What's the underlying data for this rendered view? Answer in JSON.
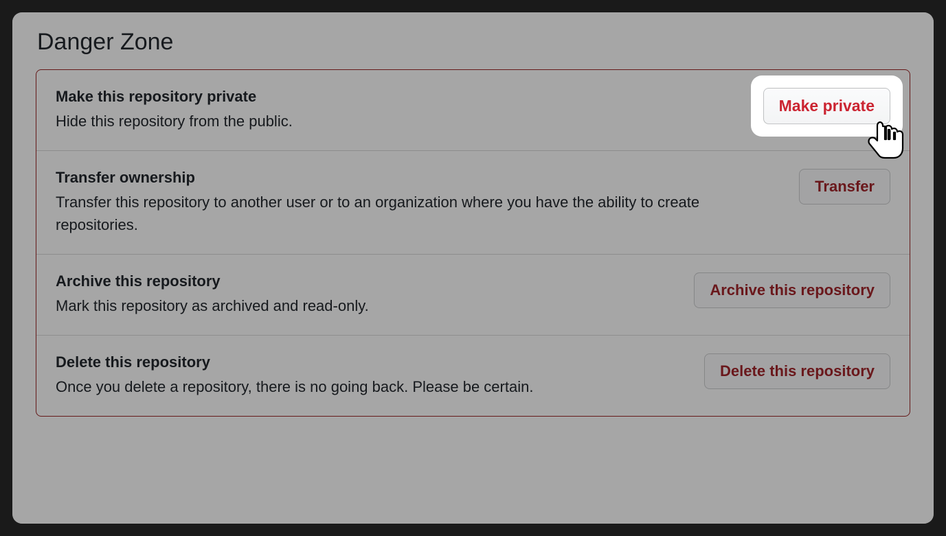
{
  "section_title": "Danger Zone",
  "rows": [
    {
      "title": "Make this repository private",
      "desc": "Hide this repository from the public.",
      "button": "Make private"
    },
    {
      "title": "Transfer ownership",
      "desc": "Transfer this repository to another user or to an organization where you have the ability to create repositories.",
      "button": "Transfer"
    },
    {
      "title": "Archive this repository",
      "desc": "Mark this repository as archived and read-only.",
      "button": "Archive this repository"
    },
    {
      "title": "Delete this repository",
      "desc": "Once you delete a repository, there is no going back. Please be certain.",
      "button": "Delete this repository"
    }
  ]
}
